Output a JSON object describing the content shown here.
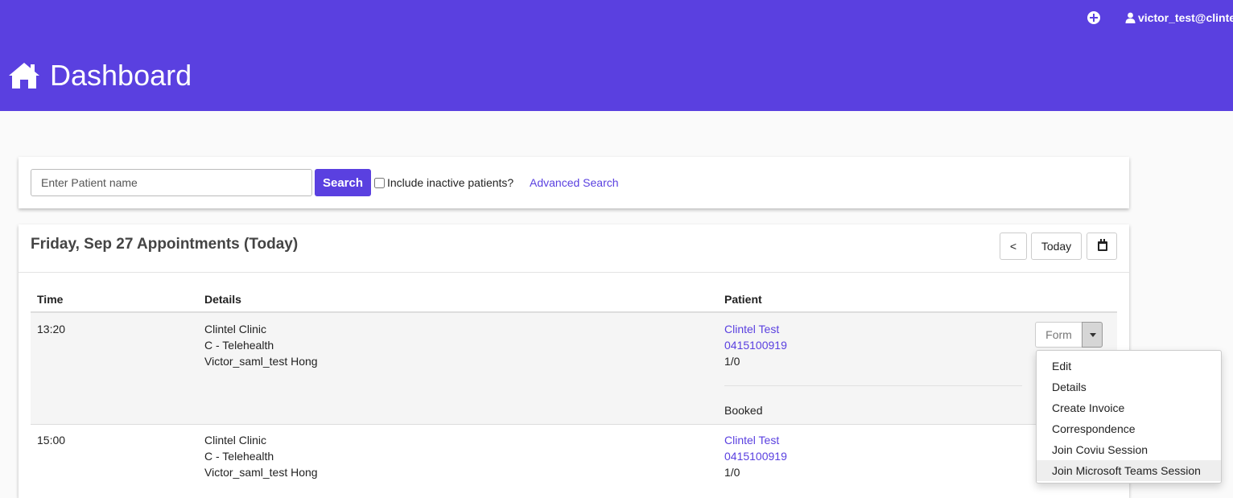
{
  "header": {
    "title": "Dashboard",
    "title_icon": "home-icon",
    "add_icon": "plus-circle-icon",
    "user_icon": "user-icon",
    "user_label": "victor_test@clintel"
  },
  "search": {
    "placeholder": "Enter Patient name",
    "button_label": "Search",
    "include_inactive_label": "Include inactive patients?",
    "include_inactive_checked": false,
    "advanced_search_label": "Advanced Search"
  },
  "appointments": {
    "heading": "Friday, Sep 27 Appointments (Today)",
    "prev_label": "<",
    "today_label": "Today",
    "calendar_icon": "calendar-icon",
    "columns": [
      "Time",
      "Details",
      "Patient"
    ],
    "rows": [
      {
        "time": "13:20",
        "details": [
          "Clintel Clinic",
          "C - Telehealth",
          "Victor_saml_test Hong"
        ],
        "patient_name": "Clintel Test",
        "patient_phone": "0415100919",
        "patient_count": "1/0",
        "status": "Booked",
        "form_label": "Form"
      },
      {
        "time": "15:00",
        "details": [
          "Clintel Clinic",
          "C - Telehealth",
          "Victor_saml_test Hong"
        ],
        "patient_name": "Clintel Test",
        "patient_phone": "0415100919",
        "patient_count": "1/0"
      }
    ]
  },
  "dropdown": {
    "items": [
      "Edit",
      "Details",
      "Create Invoice",
      "Correspondence",
      "Join Coviu Session",
      "Join Microsoft Teams Session"
    ],
    "highlighted": "Join Microsoft Teams Session"
  },
  "colors": {
    "brand": "#5a40e0",
    "page_background": "#fafafa"
  }
}
